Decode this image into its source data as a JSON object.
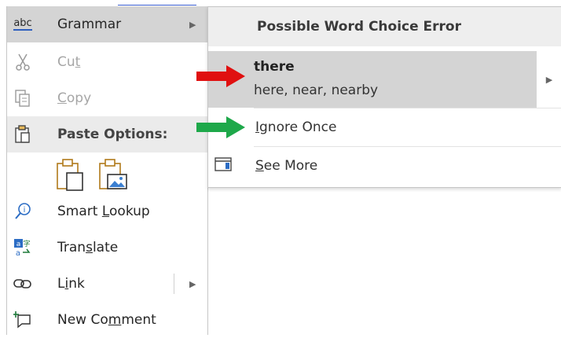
{
  "context_menu": {
    "items": [
      {
        "label": "Grammar",
        "icon": "abc-spelling-icon",
        "state": "highlighted",
        "has_submenu": true
      },
      {
        "label": "Cut",
        "icon": "scissors-icon",
        "state": "disabled"
      },
      {
        "label": "Copy",
        "icon": "copy-icon",
        "state": "disabled"
      },
      {
        "label": "Paste Options:",
        "icon": "clipboard-icon",
        "state": "header"
      },
      {
        "label": "Smart Lookup",
        "icon": "smart-lookup-icon"
      },
      {
        "label": "Translate",
        "icon": "translate-icon"
      },
      {
        "label": "Link",
        "icon": "link-icon",
        "has_submenu": true
      },
      {
        "label": "New Comment",
        "icon": "new-comment-icon"
      }
    ],
    "abc_text": "abc",
    "paste_options": [
      "keep-source-formatting-icon",
      "picture-icon"
    ]
  },
  "grammar_submenu": {
    "header": "Possible Word Choice Error",
    "suggestion_word": "there",
    "suggestion_alternatives": "here, near, nearby",
    "ignore_label": "Ignore Once",
    "see_more_label": "See More"
  },
  "annotations": {
    "red_arrow_color": "#e01010",
    "green_arrow_color": "#1ea84a"
  }
}
